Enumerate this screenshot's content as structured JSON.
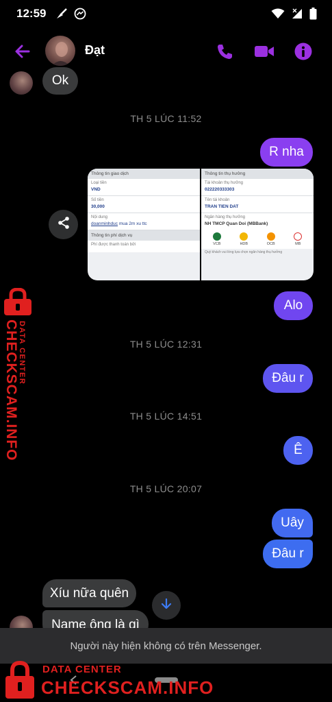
{
  "status_bar": {
    "time": "12:59",
    "icons": [
      "broom-icon",
      "messenger-icon",
      "wifi-icon",
      "no-signal-icon",
      "battery-icon"
    ]
  },
  "header": {
    "contact_name": "Đạt",
    "icons": [
      "back-arrow-icon",
      "phone-icon",
      "video-icon",
      "info-icon"
    ],
    "accent_color": "#9b30e0"
  },
  "messages": {
    "m1": "Ok",
    "ts1": "TH 5 LÚC 11:52",
    "m2": "R nha",
    "ts2": "TH 5 LÚC 12:31",
    "m3": "Alo",
    "m4": "Đâu r",
    "ts3": "TH 5 LÚC 14:51",
    "m5": "Ê",
    "ts4": "TH 5 LÚC 20:07",
    "m6": "Uây",
    "m7": "Đâu r",
    "m8": "Xíu nữa quên",
    "m9": "Name ông là gì"
  },
  "attachment": {
    "left": {
      "header": "Thông tin giao dịch",
      "amount_type_label": "Loại tiền",
      "amount_type_value": "VND",
      "amount_label": "Số tiền",
      "amount_value": "30,000",
      "content_label": "Nội dung",
      "content_value_link": "doanminhduc",
      "content_value_rest": " mua 2m xu ttc",
      "fee_header": "Thông tin phí dịch vụ",
      "fee_label": "Phí được thanh toán bởi"
    },
    "right": {
      "header": "Thông tin thụ hưởng",
      "account_label": "Tài khoản thụ hưởng",
      "account_value": "022220333303",
      "name_label": "Tên tài khoản",
      "name_value": "TRAN TIEN DAT",
      "bank_label": "Ngân hàng thụ hưởng",
      "bank_value": "NH TMCP Quan Doi (MBBank)",
      "banks": [
        "VCB",
        "HDB",
        "OCB",
        "MB"
      ],
      "footer": "Quý khách vui lòng lựa chọn ngân hàng thụ hưởng"
    }
  },
  "footer_notice": "Người này hiện không có trên Messenger.",
  "watermark": {
    "data_center": "DATA CENTER",
    "brand": "CHECKSCAM.INFO",
    "color": "#e0201f"
  },
  "colors": {
    "bubble_purple": "#8a3ff0",
    "bubble_violet": "#6a4df0",
    "bubble_blue": "#3d6df0",
    "bubble_incoming": "#3a3b3c"
  }
}
